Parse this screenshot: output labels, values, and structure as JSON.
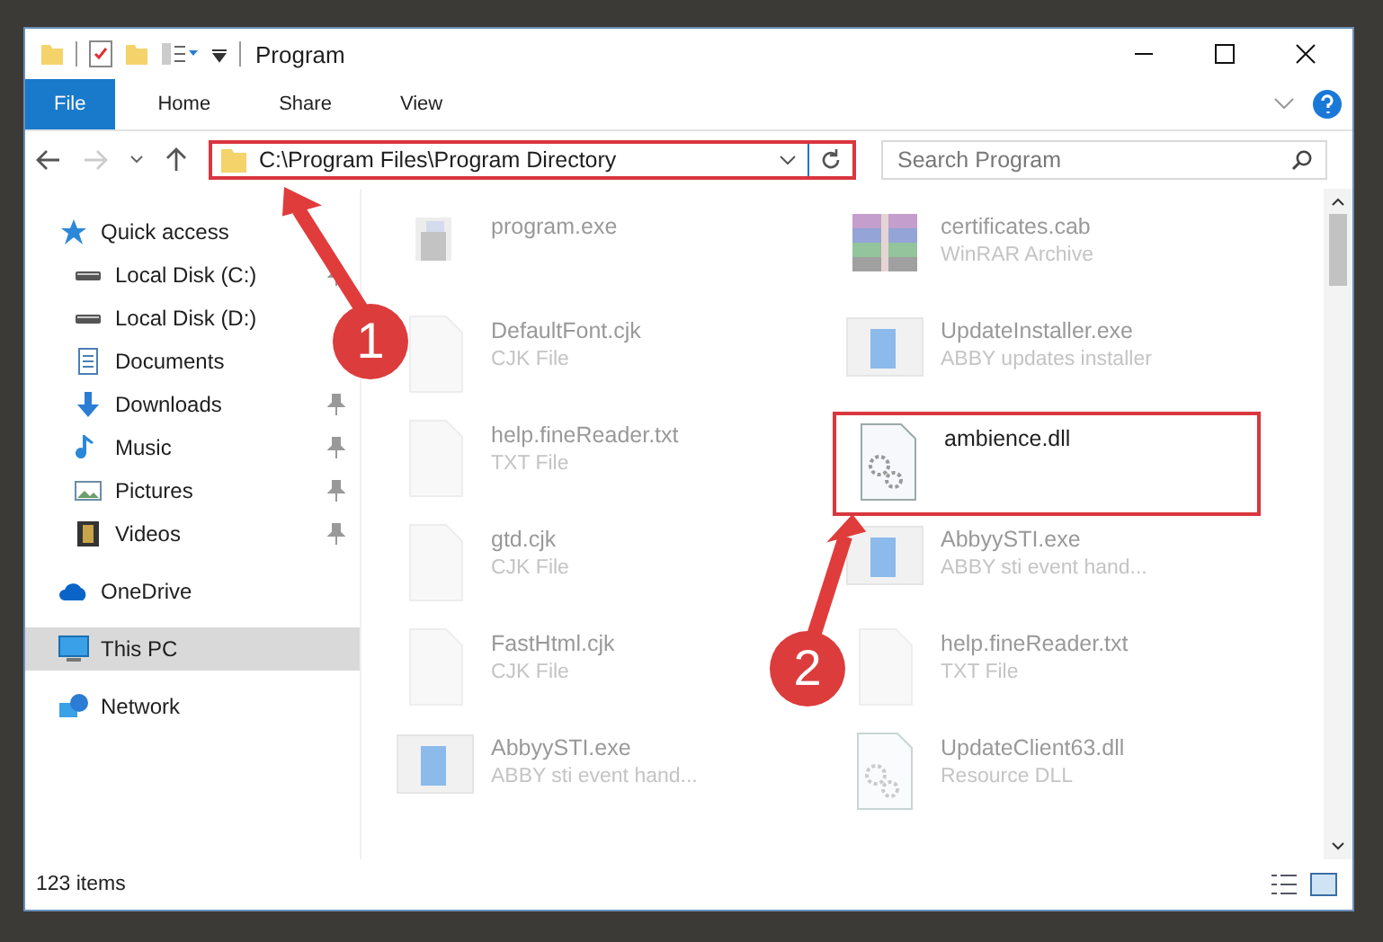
{
  "window": {
    "title": "Program"
  },
  "ribbon_tabs": [
    {
      "label": "File",
      "selected": true
    },
    {
      "label": "Home",
      "selected": false
    },
    {
      "label": "Share",
      "selected": false
    },
    {
      "label": "View",
      "selected": false
    }
  ],
  "address": {
    "path": "C:\\Program Files\\Program Directory",
    "highlighted": true
  },
  "search": {
    "placeholder": "Search Program"
  },
  "sidebar": {
    "items": [
      {
        "label": "Quick access",
        "kind": "star",
        "selected": false,
        "children": [
          {
            "label": "Local Disk (C:)",
            "kind": "drive",
            "pinned": true,
            "selected": false
          },
          {
            "label": "Local Disk (D:)",
            "kind": "drive",
            "selected": false
          },
          {
            "label": "Documents",
            "kind": "documents",
            "selected": false
          },
          {
            "label": "Downloads",
            "kind": "download",
            "pinned": true,
            "selected": false
          },
          {
            "label": "Music",
            "kind": "music",
            "pinned": true,
            "selected": false
          },
          {
            "label": "Pictures",
            "kind": "pictures",
            "pinned": true,
            "selected": false
          },
          {
            "label": "Videos",
            "kind": "videos",
            "pinned": true,
            "selected": false
          }
        ]
      },
      {
        "label": "OneDrive",
        "kind": "cloud",
        "selected": false
      },
      {
        "label": "This PC",
        "kind": "pc",
        "selected": true
      },
      {
        "label": "Network",
        "kind": "network",
        "selected": false
      }
    ]
  },
  "files": [
    {
      "name": "program.exe",
      "kind": "app",
      "blurred": true,
      "highlighted": false
    },
    {
      "name": "certificates.cab",
      "type": "WinRAR Archive",
      "kind": "archive",
      "blurred": true,
      "highlighted": false
    },
    {
      "name": "DefaultFont.cjk",
      "type": "CJK File",
      "kind": "blank",
      "blurred": true,
      "highlighted": false
    },
    {
      "name": "UpdateInstaller.exe",
      "type": "ABBY updates installer",
      "kind": "window",
      "blurred": true,
      "highlighted": false
    },
    {
      "name": "help.fineReader.txt",
      "type": "TXT File",
      "kind": "blank",
      "blurred": true,
      "highlighted": false
    },
    {
      "name": "ambience.dll",
      "kind": "dll",
      "blurred": false,
      "highlighted": true
    },
    {
      "name": "gtd.cjk",
      "type": "CJK File",
      "kind": "blank",
      "blurred": true,
      "highlighted": false
    },
    {
      "name": "AbbyySTI.exe",
      "type": "ABBY sti event hand...",
      "kind": "window",
      "blurred": true,
      "highlighted": false
    },
    {
      "name": "FastHtml.cjk",
      "type": "CJK File",
      "kind": "blank",
      "blurred": true,
      "highlighted": false
    },
    {
      "name": "help.fineReader.txt",
      "type": "TXT File",
      "kind": "blank",
      "blurred": true,
      "highlighted": false
    },
    {
      "name": "AbbyySTI.exe",
      "type": "ABBY sti event hand...",
      "kind": "window",
      "blurred": true,
      "highlighted": false
    },
    {
      "name": "UpdateClient63.dll",
      "type": "Resource DLL",
      "kind": "dll",
      "blurred": true,
      "highlighted": false
    }
  ],
  "status_bar": {
    "item_count": "123 items"
  },
  "annotations": [
    {
      "number": "1"
    },
    {
      "number": "2"
    }
  ]
}
